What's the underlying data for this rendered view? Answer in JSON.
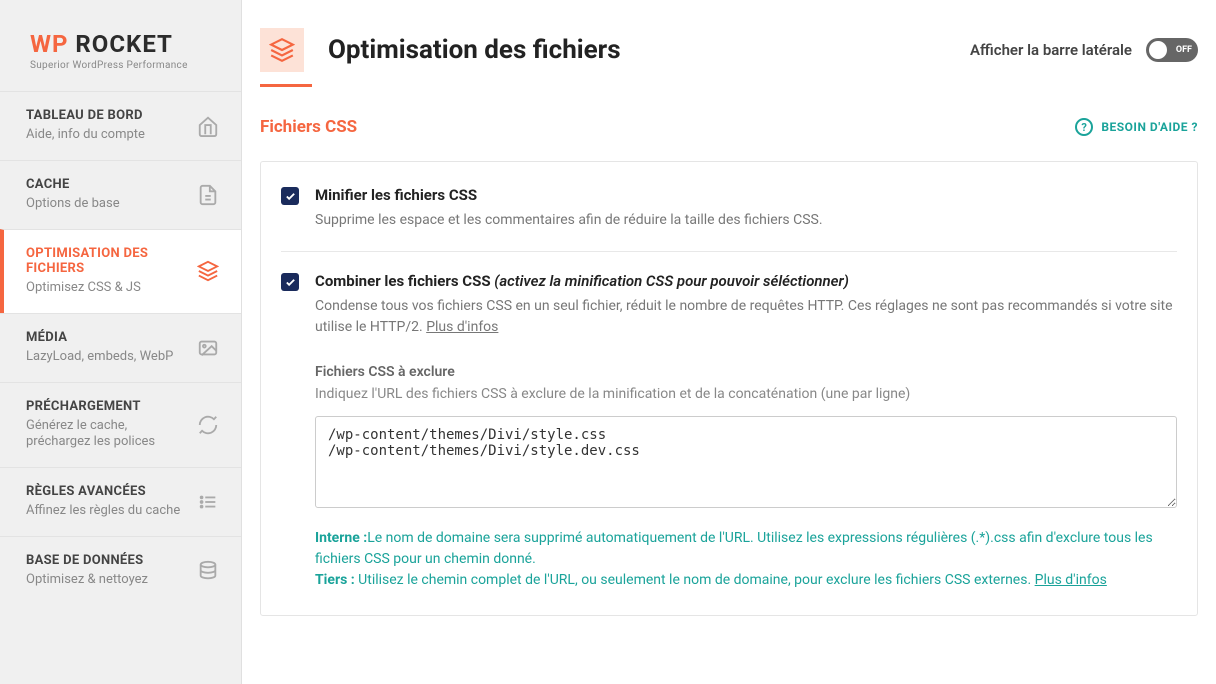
{
  "logo": {
    "prefix": "WP",
    "suffix": " ROCKET",
    "tagline": "Superior WordPress Performance"
  },
  "sidebar": {
    "items": [
      {
        "title": "TABLEAU DE BORD",
        "sub": "Aide, info du compte"
      },
      {
        "title": "CACHE",
        "sub": "Options de base"
      },
      {
        "title": "OPTIMISATION DES FICHIERS",
        "sub": "Optimisez CSS & JS"
      },
      {
        "title": "MÉDIA",
        "sub": "LazyLoad, embeds, WebP"
      },
      {
        "title": "PRÉCHARGEMENT",
        "sub": "Générez le cache, préchargez les polices"
      },
      {
        "title": "RÈGLES AVANCÉES",
        "sub": "Affinez les règles du cache"
      },
      {
        "title": "BASE DE DONNÉES",
        "sub": "Optimisez & nettoyez"
      }
    ]
  },
  "header": {
    "title": "Optimisation des fichiers",
    "sidebar_toggle_text": "Afficher la barre latérale",
    "toggle_label": "OFF"
  },
  "section": {
    "title": "Fichiers CSS",
    "help_label": "BESOIN D'AIDE ?"
  },
  "options": {
    "minify": {
      "title": "Minifier les fichiers CSS",
      "desc": "Supprime les espace et les commentaires afin de réduire la taille des fichiers CSS."
    },
    "combine": {
      "title": "Combiner les fichiers CSS",
      "suffix": "(activez la minification CSS pour pouvoir séléctionner)",
      "desc_pre": "Condense tous vos fichiers CSS en un seul fichier, réduit le nombre de requêtes HTTP. Ces réglages ne sont pas recommandés si votre site utilise le HTTP/2. ",
      "desc_link": "Plus d'infos"
    }
  },
  "exclude": {
    "title": "Fichiers CSS à exclure",
    "sub": "Indiquez l'URL des fichiers CSS à exclure de la minification et de la concaténation (une par ligne)",
    "value": "/wp-content/themes/Divi/style.css\n/wp-content/themes/Divi/style.dev.css"
  },
  "notes": {
    "interne_label": "Interne :",
    "interne_text": "Le nom de domaine sera supprimé automatiquement de l'URL. Utilisez les expressions régulières (.*).css afin d'exclure tous les fichiers CSS pour un chemin donné.",
    "tiers_label": "Tiers :",
    "tiers_text": " Utilisez le chemin complet de l'URL, ou seulement le nom de domaine, pour exclure les fichiers CSS externes. ",
    "tiers_link": "Plus d'infos"
  }
}
